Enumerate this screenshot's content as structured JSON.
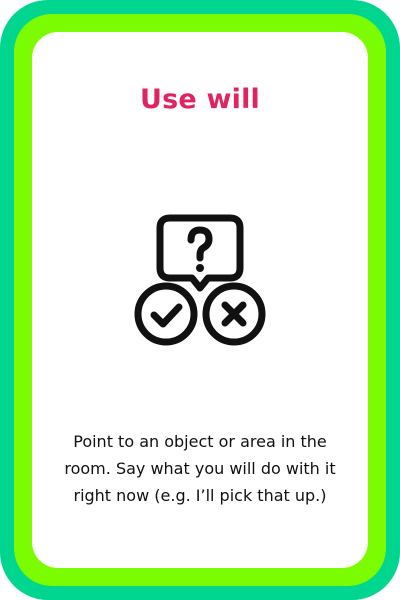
{
  "card": {
    "title": "Use will",
    "description": "Point to an object or area in the room. Say what you will do with it right now (e.g. I’ll pick that up.)",
    "icon": "question-bubble-check-cross-icon",
    "colors": {
      "outer_border": "#00d68f",
      "inner_border": "#7cfc00",
      "title": "#e0245e",
      "text": "#111111"
    }
  }
}
